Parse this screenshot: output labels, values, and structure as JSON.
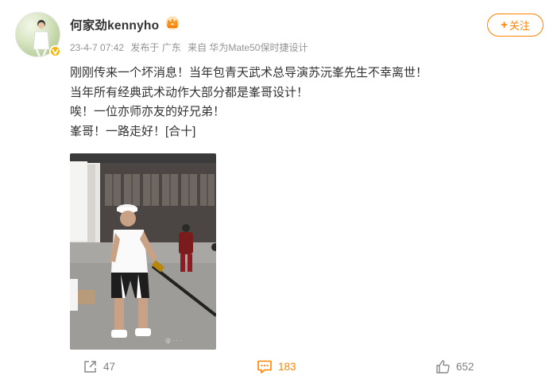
{
  "user": {
    "name": "何家劲kennyho"
  },
  "meta": {
    "time": "23-4-7 07:42",
    "location": "发布于 广东",
    "source": "来自 华为Mate50保时捷设计"
  },
  "follow": {
    "label": "关注"
  },
  "post": {
    "lines": [
      "刚刚传来一个坏消息！当年包青天武术总导演苏沅峯先生不幸离世！",
      "当年所有经典武术动作大部分都是峯哥设计！",
      "唉！一位亦师亦友的好兄弟！",
      "峯哥！一路走好！[合十]"
    ]
  },
  "toolbar": {
    "repost_count": "47",
    "comment_count": "183",
    "like_count": "652"
  },
  "colors": {
    "accent": "#ff8200",
    "muted": "#939393",
    "text": "#333333"
  }
}
